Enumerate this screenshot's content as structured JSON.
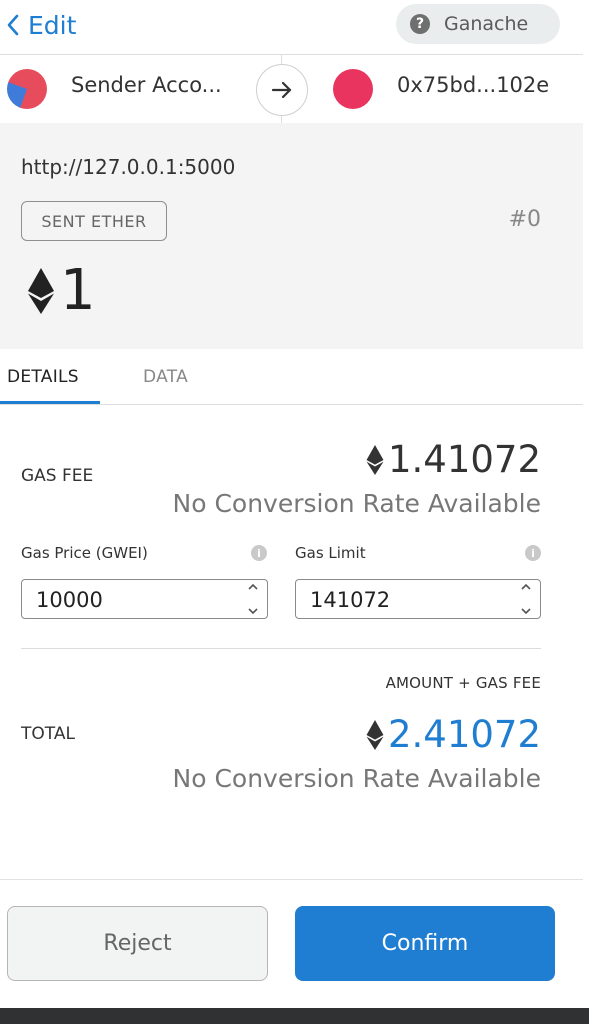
{
  "header": {
    "back_label": "Edit",
    "network_name": "Ganache",
    "network_info_glyph": "?"
  },
  "accounts": {
    "sender_name": "Sender Acco...",
    "recipient_address": "0x75bd...102e"
  },
  "summary": {
    "origin": "http://127.0.0.1:5000",
    "action": "SENT ETHER",
    "nonce": "#0",
    "amount": "1"
  },
  "tabs": {
    "details": "DETAILS",
    "data": "DATA"
  },
  "details": {
    "gas_fee_label": "GAS FEE",
    "gas_fee_amount": "1.41072",
    "gas_fee_conversion": "No Conversion Rate Available",
    "gas_price_label": "Gas Price (GWEI)",
    "gas_price_value": "10000",
    "gas_limit_label": "Gas Limit",
    "gas_limit_value": "141072",
    "amount_gas_label": "AMOUNT + GAS FEE",
    "total_label": "TOTAL",
    "total_amount": "2.41072",
    "total_conversion": "No Conversion Rate Available"
  },
  "actions": {
    "reject": "Reject",
    "confirm": "Confirm"
  },
  "colors": {
    "accent": "#1f7ed1",
    "recipient_avatar": "#e8345e"
  }
}
